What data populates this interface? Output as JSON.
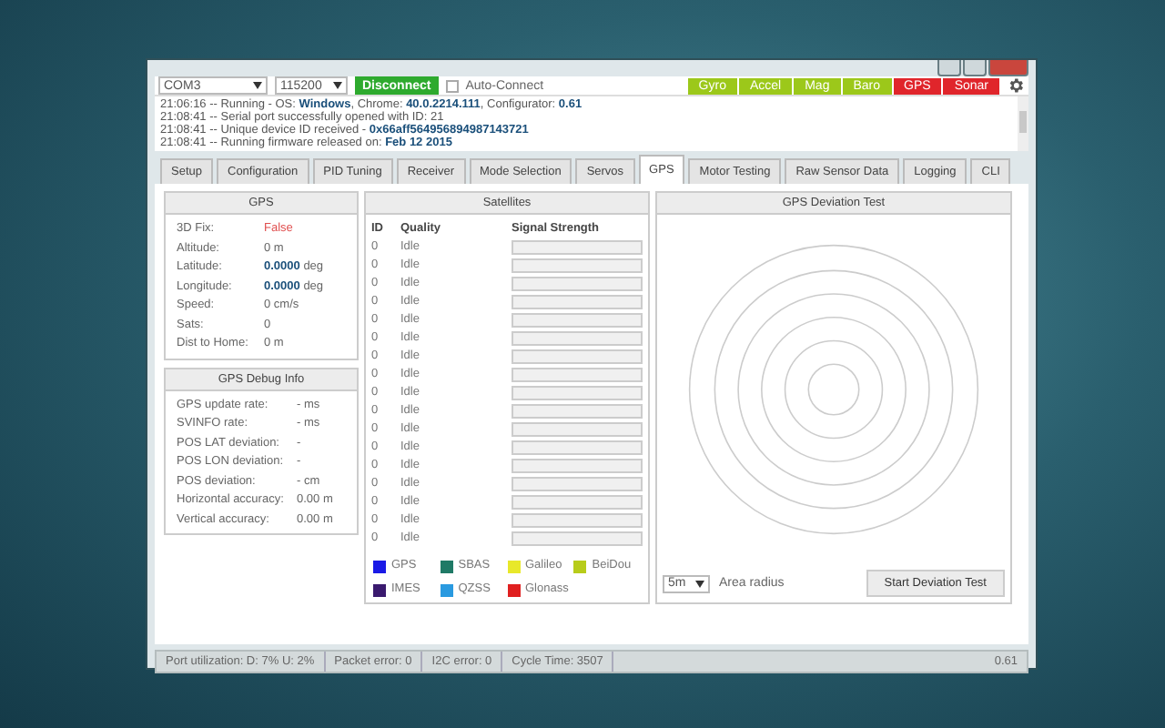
{
  "toolbar": {
    "port": "COM3",
    "baud": "115200",
    "connect_button": "Disconnect",
    "auto_connect": {
      "label": "Auto-Connect",
      "checked": false
    },
    "sensors": [
      {
        "label": "Gyro",
        "detected": true
      },
      {
        "label": "Accel",
        "detected": true
      },
      {
        "label": "Mag",
        "detected": true
      },
      {
        "label": "Baro",
        "detected": true
      },
      {
        "label": "GPS",
        "detected": false
      },
      {
        "label": "Sonar",
        "detected": false
      }
    ]
  },
  "log": [
    "21:06:16 -- Running - OS: **Windows**, Chrome: **40.0.2214.111**, Configurator: **0.61**",
    "21:08:41 -- Serial port successfully opened with ID: 21",
    "21:08:41 -- Unique device ID received - **0x66aff564956894987143721**",
    "21:08:41 -- Running firmware released on: **Feb 12 2015**"
  ],
  "tabs": [
    {
      "label": "Setup",
      "selected": false
    },
    {
      "label": "Configuration",
      "selected": false
    },
    {
      "label": "PID Tuning",
      "selected": false
    },
    {
      "label": "Receiver",
      "selected": false
    },
    {
      "label": "Mode Selection",
      "selected": false
    },
    {
      "label": "Servos",
      "selected": false
    },
    {
      "label": "GPS",
      "selected": true
    },
    {
      "label": "Motor Testing",
      "selected": false
    },
    {
      "label": "Raw Sensor Data",
      "selected": false
    },
    {
      "label": "Logging",
      "selected": false
    },
    {
      "label": "CLI",
      "selected": false
    }
  ],
  "gps": {
    "title": "GPS",
    "fields": [
      {
        "label": "3D Fix:",
        "value": "False",
        "alert": true
      },
      {
        "label": "Altitude:",
        "value": "0 m",
        "alert": false
      },
      {
        "label": "Latitude:",
        "value": "**0.0000** deg",
        "alert": false
      },
      {
        "label": "Longitude:",
        "value": "**0.0000** deg",
        "alert": false
      },
      {
        "label": "Speed:",
        "value": "0 cm/s",
        "alert": false
      },
      {
        "label": "Sats:",
        "value": "0",
        "alert": false
      },
      {
        "label": "Dist to Home:",
        "value": "0 m",
        "alert": false
      }
    ]
  },
  "debug": {
    "title": "GPS Debug Info",
    "fields": [
      {
        "label": "GPS update rate:",
        "value": "- ms"
      },
      {
        "label": "SVINFO rate:",
        "value": "- ms"
      },
      {
        "label": "POS LAT deviation:",
        "value": "-"
      },
      {
        "label": "POS LON deviation:",
        "value": "-"
      },
      {
        "label": "POS deviation:",
        "value": "- cm"
      },
      {
        "label": "Horizontal accuracy:",
        "value": "0.00 m"
      },
      {
        "label": "Vertical accuracy:",
        "value": "0.00 m"
      }
    ]
  },
  "satellites": {
    "title": "Satellites",
    "columns": [
      "ID",
      "Quality",
      "Signal Strength"
    ],
    "rows": [
      {
        "id": "0",
        "quality": "Idle",
        "level": 0
      },
      {
        "id": "0",
        "quality": "Idle",
        "level": 0
      },
      {
        "id": "0",
        "quality": "Idle",
        "level": 0
      },
      {
        "id": "0",
        "quality": "Idle",
        "level": 0
      },
      {
        "id": "0",
        "quality": "Idle",
        "level": 0
      },
      {
        "id": "0",
        "quality": "Idle",
        "level": 0
      },
      {
        "id": "0",
        "quality": "Idle",
        "level": 0
      },
      {
        "id": "0",
        "quality": "Idle",
        "level": 0
      },
      {
        "id": "0",
        "quality": "Idle",
        "level": 0
      },
      {
        "id": "0",
        "quality": "Idle",
        "level": 0
      },
      {
        "id": "0",
        "quality": "Idle",
        "level": 0
      },
      {
        "id": "0",
        "quality": "Idle",
        "level": 0
      },
      {
        "id": "0",
        "quality": "Idle",
        "level": 0
      },
      {
        "id": "0",
        "quality": "Idle",
        "level": 0
      },
      {
        "id": "0",
        "quality": "Idle",
        "level": 0
      },
      {
        "id": "0",
        "quality": "Idle",
        "level": 0
      },
      {
        "id": "0",
        "quality": "Idle",
        "level": 0
      }
    ],
    "legend": [
      {
        "label": "GPS",
        "color": "#1a1ae6"
      },
      {
        "label": "SBAS",
        "color": "#1f7a66"
      },
      {
        "label": "Galileo",
        "color": "#e8e82a"
      },
      {
        "label": "BeiDou",
        "color": "#b8cc1a"
      },
      {
        "label": "IMES",
        "color": "#3a1a6e"
      },
      {
        "label": "QZSS",
        "color": "#2a9ae0"
      },
      {
        "label": "Glonass",
        "color": "#e02020"
      }
    ]
  },
  "deviation": {
    "title": "GPS Deviation Test",
    "radius": "5m",
    "radius_label": "Area radius",
    "button": "Start Deviation Test"
  },
  "status_bar": {
    "items": [
      "Port utilization: D: 7% U: 2%",
      "Packet error: 0",
      "I2C error: 0",
      "Cycle Time: 3507"
    ],
    "version": "0.61"
  }
}
